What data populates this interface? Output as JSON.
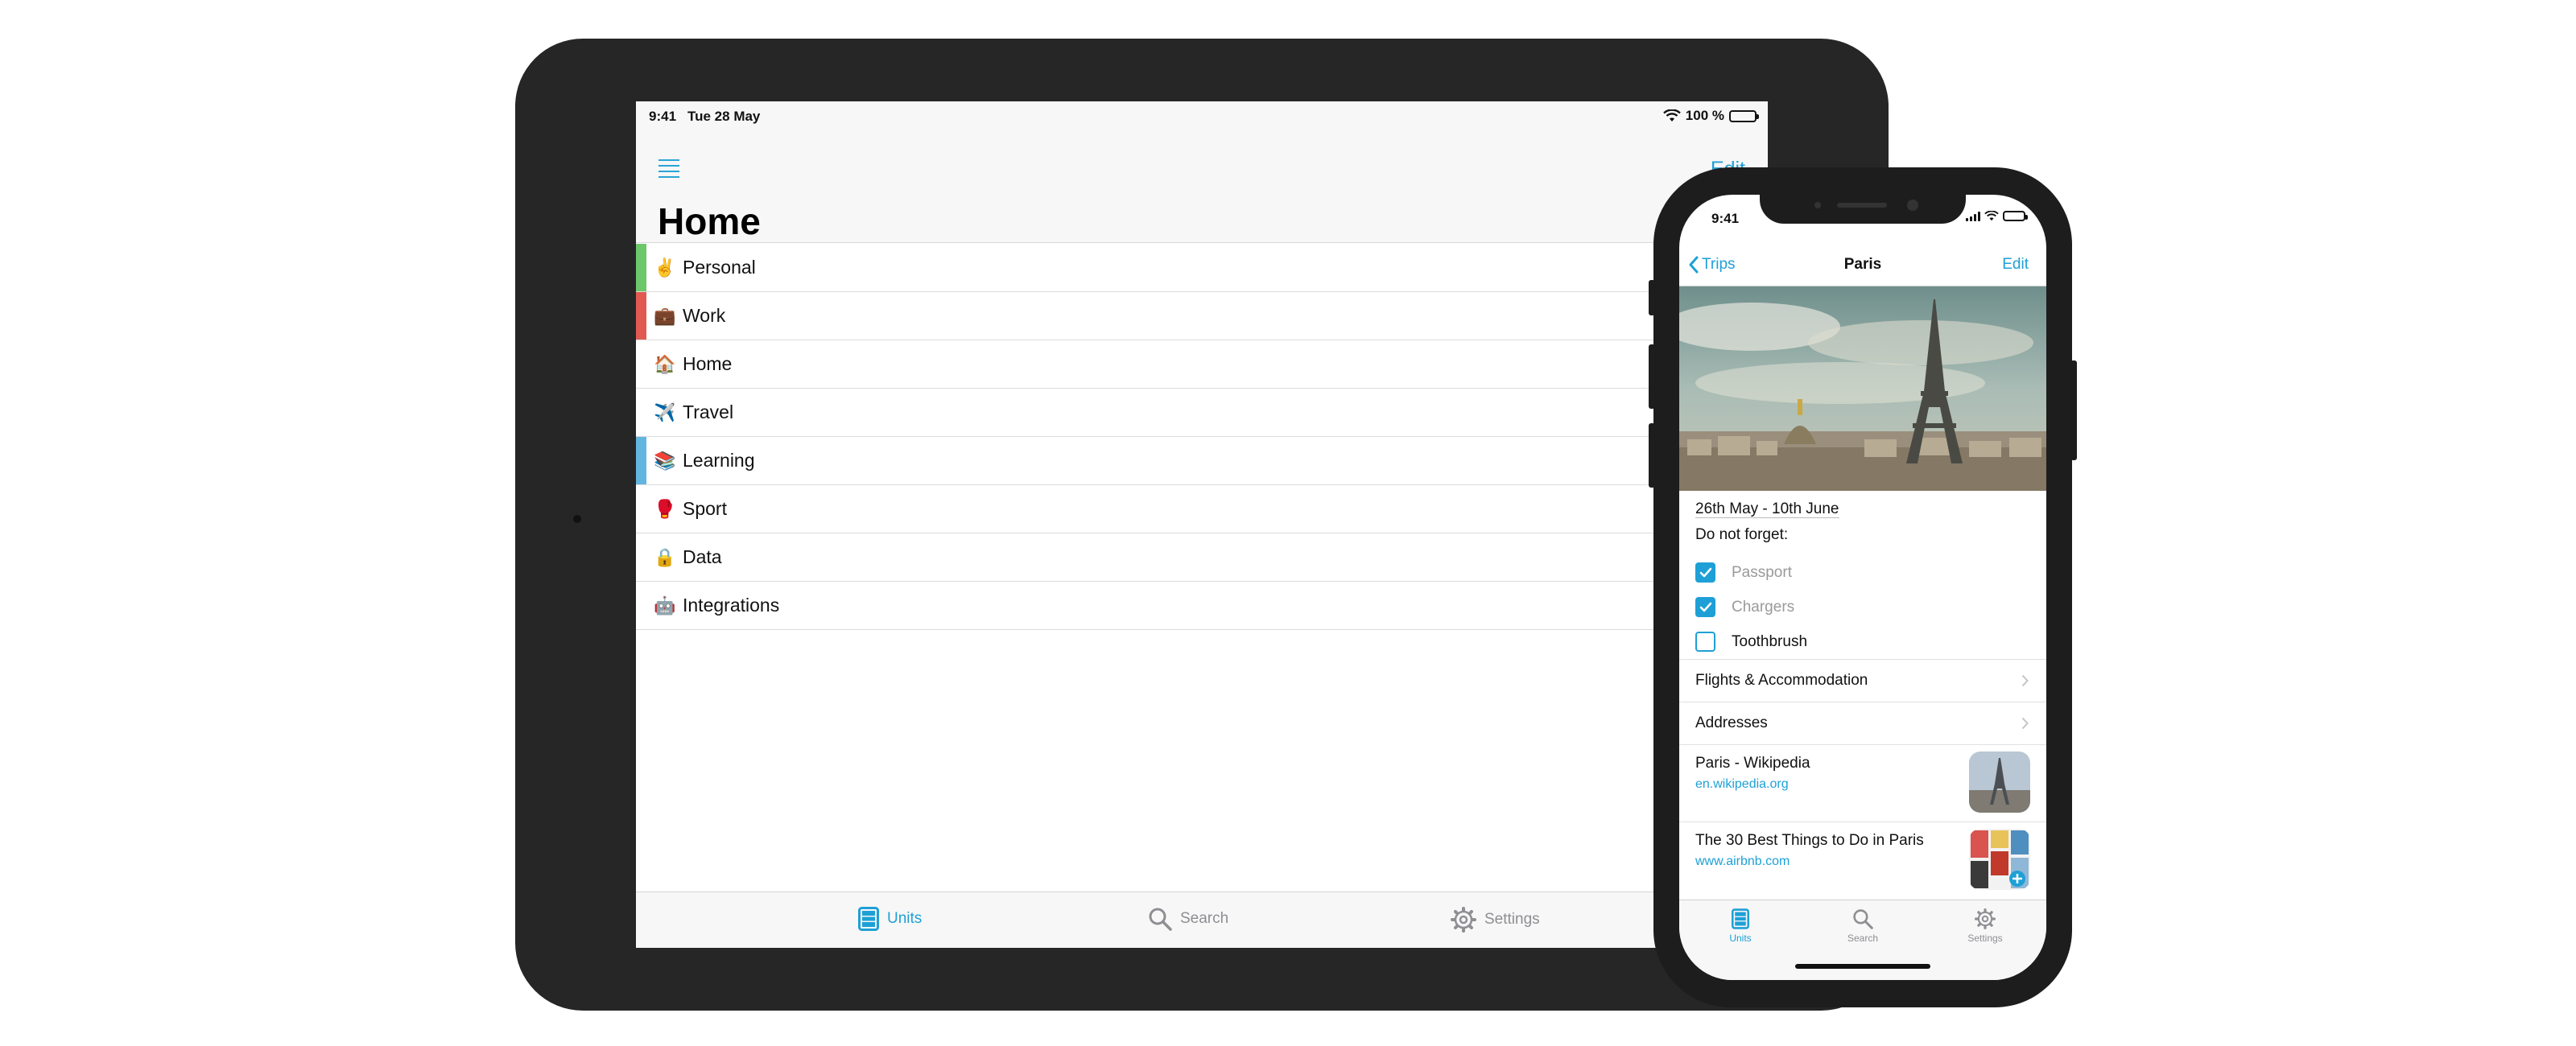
{
  "ipad": {
    "status": {
      "time": "9:41",
      "date": "Tue 28 May",
      "battery": "100 %"
    },
    "nav": {
      "title": "Home",
      "edit_label": "Edit"
    },
    "units": [
      {
        "emoji": "✌️",
        "label": "Personal",
        "color": "#6cc66a"
      },
      {
        "emoji": "💼",
        "label": "Work",
        "color": "#e05a52"
      },
      {
        "emoji": "🏠",
        "label": "Home",
        "color": ""
      },
      {
        "emoji": "✈️",
        "label": "Travel",
        "color": ""
      },
      {
        "emoji": "📚",
        "label": "Learning",
        "color": "#62b5de"
      },
      {
        "emoji": "🥊",
        "label": "Sport",
        "color": ""
      },
      {
        "emoji": "🔒",
        "label": "Data",
        "color": ""
      },
      {
        "emoji": "🤖",
        "label": "Integrations",
        "color": ""
      }
    ],
    "tabs": [
      {
        "label": "Units",
        "icon": "units-icon"
      },
      {
        "label": "Search",
        "icon": "search-icon"
      },
      {
        "label": "Settings",
        "icon": "gear-icon"
      }
    ]
  },
  "iphone": {
    "status": {
      "time": "9:41"
    },
    "nav": {
      "back_label": "Trips",
      "title": "Paris",
      "edit_label": "Edit"
    },
    "dates": "26th May - 10th June",
    "forget_label": "Do not forget:",
    "checklist": [
      {
        "label": "Passport",
        "checked": true
      },
      {
        "label": "Chargers",
        "checked": true
      },
      {
        "label": "Toothbrush",
        "checked": false
      }
    ],
    "links": [
      {
        "label": "Flights & Accommodation"
      },
      {
        "label": "Addresses"
      }
    ],
    "web_links": [
      {
        "title": "Paris - Wikipedia",
        "url": "en.wikipedia.org"
      },
      {
        "title": "The 30 Best Things to Do in Paris",
        "url": "www.airbnb.com"
      }
    ],
    "tabs": [
      {
        "label": "Units",
        "icon": "units-icon"
      },
      {
        "label": "Search",
        "icon": "search-icon"
      },
      {
        "label": "Settings",
        "icon": "gear-icon"
      }
    ]
  },
  "colors": {
    "accent": "#1ea0d6"
  }
}
